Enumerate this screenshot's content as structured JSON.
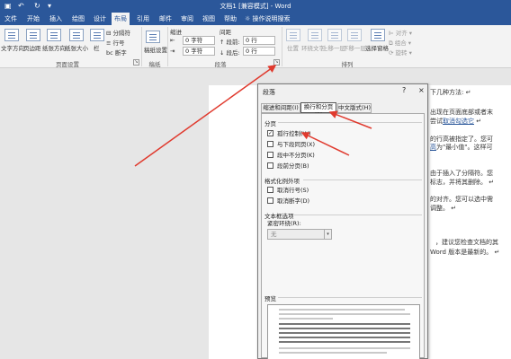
{
  "titlebar": {
    "title": "文档1 [兼容模式] - Word",
    "quick_access": [
      "save-icon",
      "undo-icon",
      "redo-icon",
      "customize-icon"
    ]
  },
  "tabs": [
    {
      "label": "文件",
      "active": false
    },
    {
      "label": "开始",
      "active": false
    },
    {
      "label": "插入",
      "active": false
    },
    {
      "label": "绘图",
      "active": false
    },
    {
      "label": "设计",
      "active": false
    },
    {
      "label": "布局",
      "active": true
    },
    {
      "label": "引用",
      "active": false
    },
    {
      "label": "邮件",
      "active": false
    },
    {
      "label": "审阅",
      "active": false
    },
    {
      "label": "视图",
      "active": false
    },
    {
      "label": "帮助",
      "active": false
    },
    {
      "label": "操作说明搜索",
      "active": false
    }
  ],
  "ribbon": {
    "page_setup": {
      "buttons": [
        "文字方向",
        "页边距",
        "纸张方向",
        "纸张大小",
        "栏"
      ],
      "small": [
        "分隔符",
        "行号",
        "断字"
      ],
      "label": "页面设置"
    },
    "manuscript": {
      "button": "稿纸设置",
      "label": "稿纸"
    },
    "paragraph": {
      "indent_title": "缩进",
      "spacing_title": "间距",
      "indent_left_value": "0 字符",
      "indent_right_value": "0 字符",
      "spacing_before_label": "段前:",
      "spacing_after_label": "段后:",
      "spacing_before_value": "0 行",
      "spacing_after_value": "0 行",
      "label": "段落"
    },
    "arrange": {
      "buttons": [
        "位置",
        "环绕文字",
        "上移一层",
        "下移一层",
        "选择窗格"
      ],
      "small": [
        "对齐",
        "组合",
        "旋转"
      ],
      "label": "排列"
    }
  },
  "document": {
    "lines": [
      {
        "text": "下几种方法:",
        "link": ""
      },
      {
        "text": "出现在页面底部或者末",
        "link": ""
      },
      {
        "text": "尝试",
        "link": "取消勾选它"
      },
      {
        "text": "的行高被指定了。您可",
        "link": ""
      },
      {
        "text": "",
        "link": "高",
        "rest": "为\"最小值\"。这样可"
      },
      {
        "text": "由于插入了分隔符。您",
        "link": ""
      },
      {
        "text": "标志，并将其删除。",
        "link": ""
      },
      {
        "text": "的对齐。您可以选中需",
        "link": ""
      },
      {
        "text": "调整。",
        "link": ""
      },
      {
        "text": "，建议您检查文档的其",
        "link": ""
      },
      {
        "text": "Word 版本是最新的。",
        "link": ""
      }
    ]
  },
  "dialog": {
    "title": "段落",
    "help": "?",
    "close": "×",
    "tabs": [
      "缩进和间距(I)",
      "换行和分页(P)",
      "中文版式(H)"
    ],
    "pagination": {
      "title": "分页",
      "options": [
        {
          "label": "孤行控制(W)",
          "checked": true
        },
        {
          "label": "与下段同页(X)",
          "checked": false
        },
        {
          "label": "段中不分页(K)",
          "checked": false
        },
        {
          "label": "段前分页(B)",
          "checked": false
        }
      ]
    },
    "formatting_exceptions": {
      "title": "格式化例外项",
      "options": [
        {
          "label": "取消行号(S)",
          "checked": false
        },
        {
          "label": "取消断字(D)",
          "checked": false
        }
      ]
    },
    "textbox": {
      "title": "文本框选项",
      "wrap_label": "紧密环绕(R):",
      "wrap_value": "无"
    },
    "preview_title": "预览"
  },
  "annotation_color": "#e03a2e"
}
